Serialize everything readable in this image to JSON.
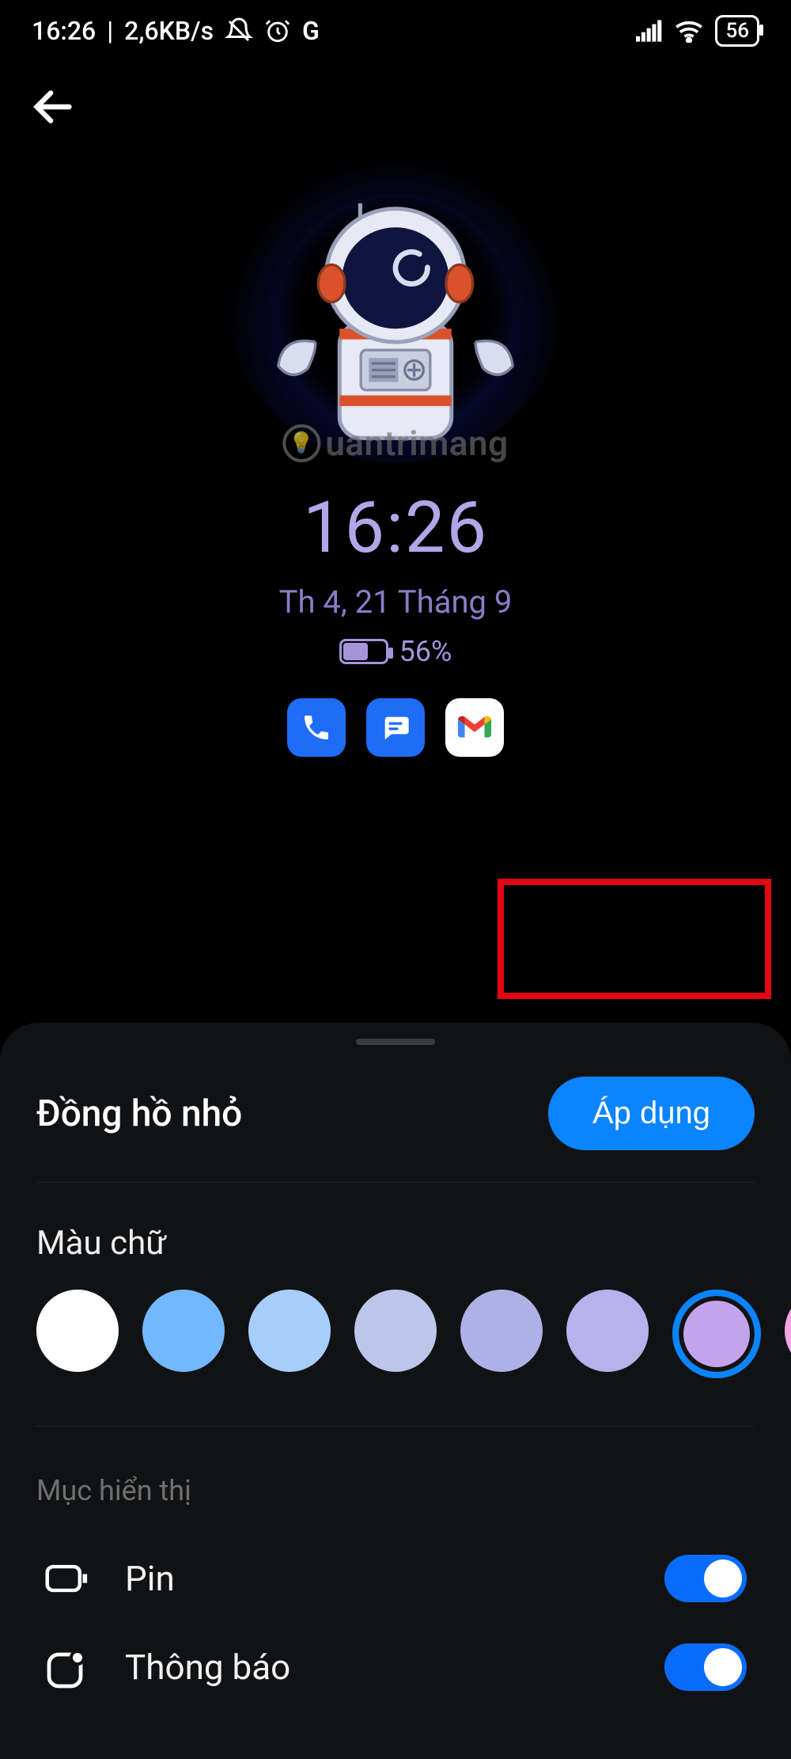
{
  "status": {
    "time": "16:26",
    "speed": "2,6KB/s",
    "battery": "56"
  },
  "preview": {
    "watermark": "uantrimang",
    "time": "16:26",
    "date": "Th 4, 21 Tháng 9",
    "battery_percent": "56%"
  },
  "sheet": {
    "title": "Đồng hồ nhỏ",
    "apply_label": "Áp dụng",
    "text_color_label": "Màu chữ",
    "colors": [
      {
        "hex": "#ffffff",
        "selected": false
      },
      {
        "hex": "#73b7ff",
        "selected": false
      },
      {
        "hex": "#a7cdfb",
        "selected": false
      },
      {
        "hex": "#bcc6ea",
        "selected": false
      },
      {
        "hex": "#adb1e6",
        "selected": false
      },
      {
        "hex": "#b7b1ec",
        "selected": false
      },
      {
        "hex": "#c3a4ec",
        "selected": true
      },
      {
        "hex": "#f2a6e6",
        "selected": false
      }
    ],
    "display_section_label": "Mục hiển thị",
    "toggles": {
      "battery": {
        "label": "Pin",
        "on": true
      },
      "notifications": {
        "label": "Thông báo",
        "on": true
      }
    }
  }
}
